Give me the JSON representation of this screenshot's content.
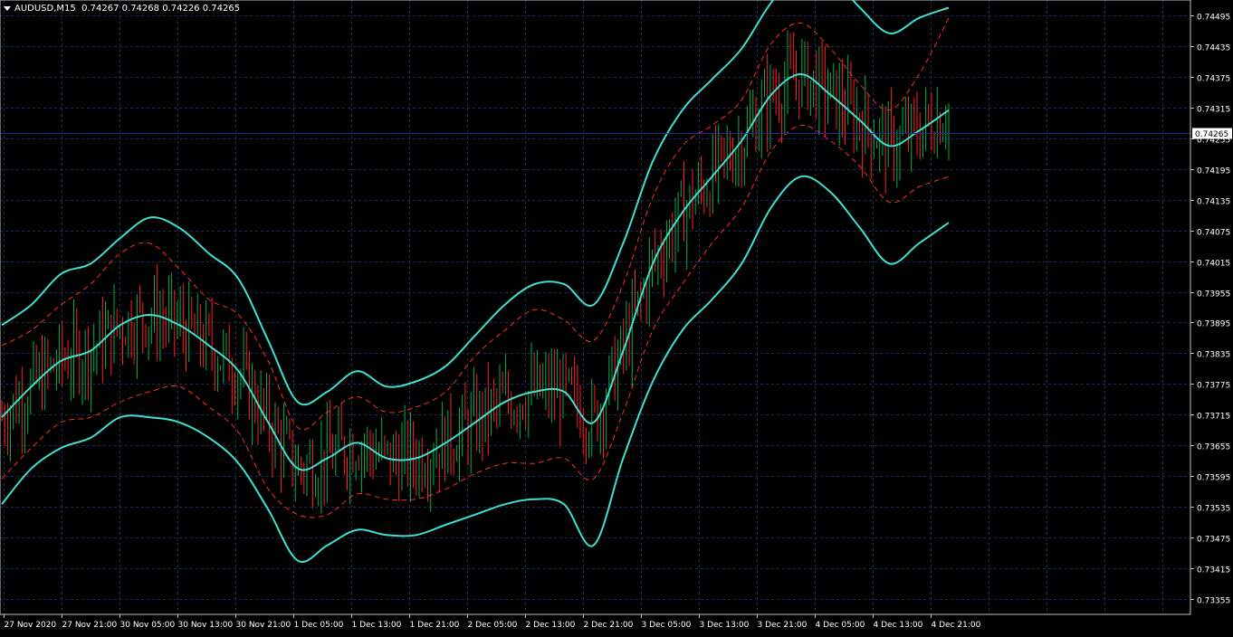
{
  "header": {
    "symbol": "AUDUSD,M15",
    "quote": "0.74267 0.74268 0.74226 0.74265"
  },
  "current_price_label": "0.74265",
  "colors": {
    "background": "#000000",
    "grid": "#1a2a5a",
    "axis_text": "#ffffff",
    "outer_bands": "#40e0d0",
    "inner_bands": "#ff2a2a",
    "candle_up": "#00b050",
    "candle_down": "#ff2020",
    "price_line": "#1f2f8f"
  },
  "chart_data": {
    "type": "line",
    "title": "AUDUSD,M15",
    "y_axis_position": "right",
    "grid": true,
    "ylim": [
      0.73325,
      0.74525
    ],
    "y_ticks": [
      "0.74495",
      "0.74435",
      "0.74375",
      "0.74315",
      "0.74255",
      "0.74195",
      "0.74135",
      "0.74075",
      "0.74015",
      "0.73955",
      "0.73895",
      "0.73835",
      "0.73775",
      "0.73715",
      "0.73655",
      "0.73595",
      "0.73535",
      "0.73475",
      "0.73415",
      "0.73355"
    ],
    "x_ticks": [
      "27 Nov 2020",
      "27 Nov 21:00",
      "30 Nov 05:00",
      "30 Nov 13:00",
      "30 Nov 21:00",
      "1 Dec 05:00",
      "1 Dec 13:00",
      "1 Dec 21:00",
      "2 Dec 05:00",
      "2 Dec 13:00",
      "2 Dec 21:00",
      "3 Dec 05:00",
      "3 Dec 13:00",
      "3 Dec 21:00",
      "4 Dec 05:00",
      "4 Dec 13:00",
      "4 Dec 21:00"
    ],
    "last_price": 0.74265,
    "series": [
      {
        "role": "outer-upper",
        "values": [
          0.7389,
          0.7393,
          0.7399,
          0.7401,
          0.7406,
          0.741,
          0.7408,
          0.7403,
          0.7398,
          0.7386,
          0.7374,
          0.7376,
          0.738,
          0.7377,
          0.7378,
          0.7381,
          0.7387,
          0.7393,
          0.7397,
          0.7397,
          0.7393,
          0.7405,
          0.7421,
          0.7431,
          0.7437,
          0.7443,
          0.7452,
          0.7458,
          0.7457,
          0.7451,
          0.7446,
          0.7449,
          0.7451
        ]
      },
      {
        "role": "middle",
        "values": [
          0.7371,
          0.7377,
          0.7382,
          0.7384,
          0.7389,
          0.7391,
          0.7389,
          0.7385,
          0.738,
          0.737,
          0.7361,
          0.7363,
          0.7366,
          0.7363,
          0.7363,
          0.7366,
          0.737,
          0.7374,
          0.7376,
          0.7376,
          0.737,
          0.7384,
          0.7401,
          0.7411,
          0.7418,
          0.7425,
          0.7434,
          0.7438,
          0.7434,
          0.7429,
          0.7424,
          0.7427,
          0.7431
        ]
      },
      {
        "role": "outer-lower",
        "values": [
          0.7354,
          0.7361,
          0.7365,
          0.7367,
          0.7371,
          0.7371,
          0.737,
          0.7367,
          0.7362,
          0.7353,
          0.7343,
          0.7346,
          0.7349,
          0.7348,
          0.7348,
          0.735,
          0.7352,
          0.7354,
          0.7355,
          0.7354,
          0.7346,
          0.7363,
          0.7378,
          0.7388,
          0.7394,
          0.7401,
          0.7412,
          0.7418,
          0.7415,
          0.7408,
          0.7401,
          0.7405,
          0.7409
        ]
      },
      {
        "role": "inner-upper",
        "values": [
          0.7385,
          0.7388,
          0.7393,
          0.7397,
          0.7403,
          0.7405,
          0.74,
          0.7394,
          0.7391,
          0.7382,
          0.7369,
          0.7372,
          0.7375,
          0.7372,
          0.7373,
          0.7376,
          0.7383,
          0.7388,
          0.7392,
          0.739,
          0.7386,
          0.7397,
          0.7414,
          0.7424,
          0.7428,
          0.7433,
          0.7444,
          0.7448,
          0.7443,
          0.7436,
          0.7431,
          0.7438,
          0.7449
        ]
      },
      {
        "role": "inner-lower",
        "values": [
          0.7359,
          0.7365,
          0.737,
          0.7371,
          0.7374,
          0.7376,
          0.7377,
          0.7373,
          0.7368,
          0.7357,
          0.7352,
          0.7352,
          0.7356,
          0.7355,
          0.7355,
          0.7357,
          0.736,
          0.7362,
          0.7362,
          0.7363,
          0.7359,
          0.7372,
          0.7388,
          0.7397,
          0.7405,
          0.7412,
          0.7423,
          0.7428,
          0.7425,
          0.742,
          0.7413,
          0.7416,
          0.7418
        ]
      }
    ]
  }
}
